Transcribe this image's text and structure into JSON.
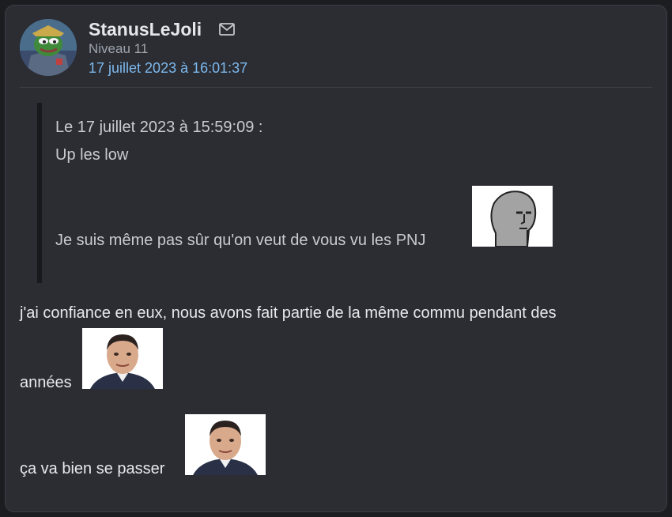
{
  "post": {
    "author": "StanusLeJoli",
    "level": "Niveau 11",
    "date": "17 juillet 2023 à 16:01:37",
    "avatar_icon": "pepe-soldier-avatar",
    "mail_icon": "envelope-icon"
  },
  "quote": {
    "header": "Le 17 juillet 2023 à 15:59:09 :",
    "line1": "Up les low",
    "line2": "Je suis même pas sûr qu'on veut de vous vu les PNJ",
    "sticker": "npc-wojak-sticker"
  },
  "message": {
    "line1": "j'ai confiance en eux, nous avons fait partie de la même commu pendant des",
    "line2": "années",
    "line3": "ça va bien se passer",
    "sticker": "man-portrait-sticker"
  },
  "colors": {
    "background": "#2b2d33",
    "accent_link": "#7db9ee",
    "quote_bar": "#18191d"
  }
}
